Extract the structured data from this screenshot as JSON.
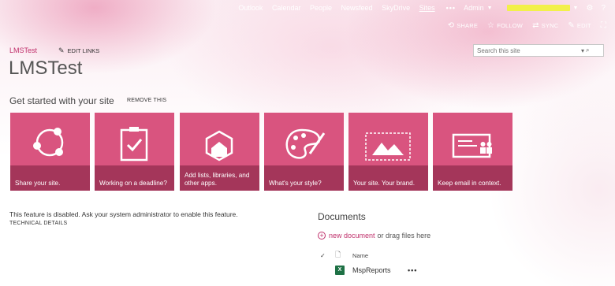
{
  "suite_bar": {
    "nav": [
      "Outlook",
      "Calendar",
      "People",
      "Newsfeed",
      "SkyDrive",
      "Sites"
    ],
    "active": "Sites",
    "more": "•••",
    "user": "Admin"
  },
  "actions": [
    {
      "icon": "share-icon",
      "label": "SHARE"
    },
    {
      "icon": "star-icon",
      "label": "FOLLOW"
    },
    {
      "icon": "sync-icon",
      "label": "SYNC"
    },
    {
      "icon": "pencil-icon",
      "label": "EDIT"
    }
  ],
  "breadcrumb": "LMSTest",
  "edit_links": "EDIT LINKS",
  "search": {
    "placeholder": "Search this site"
  },
  "site_title": "LMSTest",
  "get_started": {
    "title": "Get started with your site",
    "remove": "REMOVE THIS",
    "tiles": [
      {
        "icon": "share-site-icon",
        "caption": "Share your site."
      },
      {
        "icon": "task-checklist-icon",
        "caption": "Working on a deadline?"
      },
      {
        "icon": "add-apps-icon",
        "caption": "Add lists, libraries, and other apps."
      },
      {
        "icon": "palette-icon",
        "caption": "What's your style?"
      },
      {
        "icon": "brand-image-icon",
        "caption": "Your site. Your brand."
      },
      {
        "icon": "email-context-icon",
        "caption": "Keep email in context."
      }
    ]
  },
  "feature": {
    "message": "This feature is disabled. Ask your system administrator to enable this feature.",
    "details": "TECHNICAL DETAILS"
  },
  "documents": {
    "title": "Documents",
    "new_link": "new document",
    "new_suffix": "or drag files here",
    "column_name": "Name",
    "rows": [
      {
        "name": "MspReports",
        "type_badge": "X"
      }
    ],
    "row_more": "•••"
  },
  "colors": {
    "accent": "#c0306b",
    "tile": "#d9547f",
    "highlight": "#f2f04a"
  }
}
